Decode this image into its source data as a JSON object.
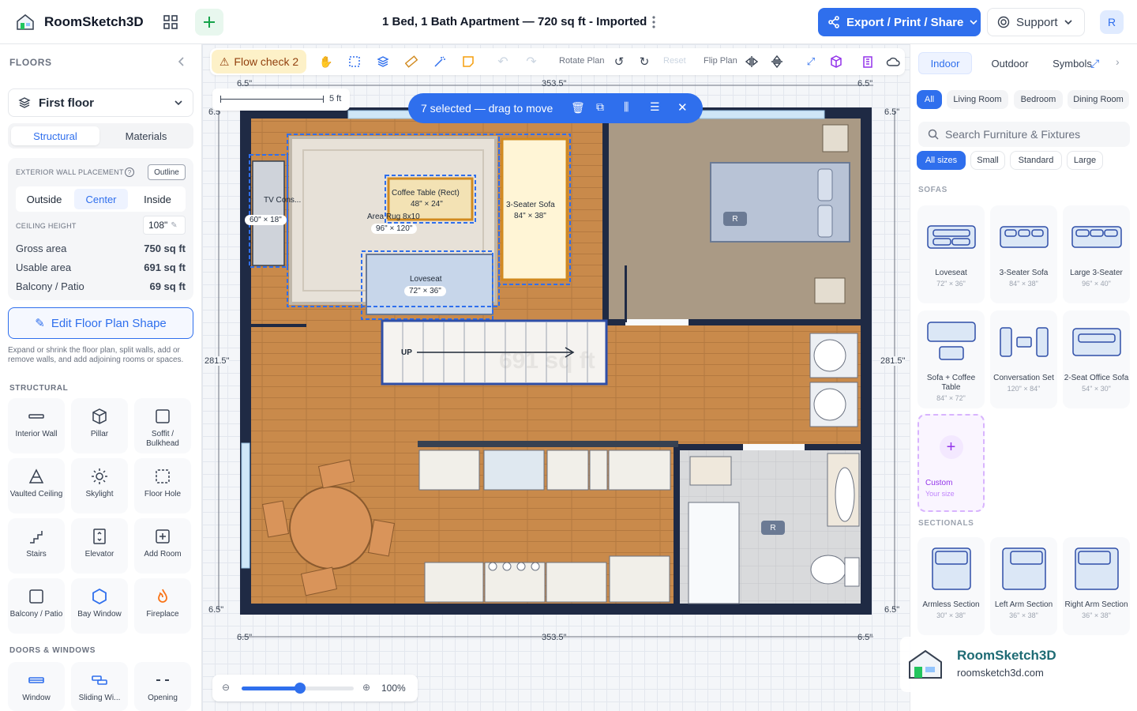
{
  "app": {
    "name": "RoomSketch3D",
    "doc_title": "1 Bed, 1 Bath Apartment — 720 sq ft - Imported",
    "export_label": "Export / Print / Share",
    "support_label": "Support",
    "avatar": "R",
    "accent": "#2f6fed"
  },
  "left": {
    "floors_header": "FLOORS",
    "floor_select": "First floor",
    "tabs": [
      "Structural",
      "Materials"
    ],
    "wall_label": "EXTERIOR WALL PLACEMENT",
    "outline_btn": "Outline",
    "wall_options": [
      "Outside",
      "Center",
      "Inside"
    ],
    "ceiling_label": "CEILING HEIGHT",
    "ceiling_value": "108\"",
    "stats": [
      {
        "label": "Gross area",
        "value": "750 sq ft"
      },
      {
        "label": "Usable area",
        "value": "691 sq ft"
      },
      {
        "label": "Balcony / Patio",
        "value": "69 sq ft"
      }
    ],
    "edit_btn": "Edit Floor Plan Shape",
    "edit_help": "Expand or shrink the floor plan, split walls, add or remove walls, and add adjoining rooms or spaces.",
    "structural_header": "STRUCTURAL",
    "structural": [
      {
        "label": "Interior Wall",
        "icon": "wall-icon"
      },
      {
        "label": "Pillar",
        "icon": "cube-icon"
      },
      {
        "label": "Soffit / Bulkhead",
        "icon": "square-icon"
      },
      {
        "label": "Vaulted Ceiling",
        "icon": "vault-icon"
      },
      {
        "label": "Skylight",
        "icon": "sun-icon"
      },
      {
        "label": "Floor Hole",
        "icon": "dashed-square-icon"
      },
      {
        "label": "Stairs",
        "icon": "stairs-icon"
      },
      {
        "label": "Elevator",
        "icon": "elevator-icon"
      },
      {
        "label": "Add Room",
        "icon": "plus-square-icon"
      },
      {
        "label": "Balcony / Patio",
        "icon": "balcony-icon"
      },
      {
        "label": "Bay Window",
        "icon": "hexagon-icon"
      },
      {
        "label": "Fireplace",
        "icon": "flame-icon"
      }
    ],
    "doors_header": "DOORS & WINDOWS",
    "doors": [
      {
        "label": "Window",
        "icon": "window-icon"
      },
      {
        "label": "Sliding Wi...",
        "icon": "sliding-window-icon"
      },
      {
        "label": "Opening",
        "icon": "opening-icon"
      }
    ]
  },
  "toolbar": {
    "flow_check": "Flow check 2",
    "rotate_plan": "Rotate Plan",
    "reset": "Reset",
    "flip_plan": "Flip Plan"
  },
  "selection": {
    "text": "7 selected — drag to move"
  },
  "plan": {
    "dim_top": "353.5\"",
    "dim_bottom": "353.5\"",
    "dim_side": "281.5\"",
    "dim_corner": "6.5\"",
    "scale": "5 ft",
    "area_watermark": "691 sq ft",
    "items": [
      {
        "name": "TV Cons...",
        "size": "60\" × 18\""
      },
      {
        "name": "Coffee Table (Rect)",
        "size": "48\" × 24\""
      },
      {
        "name": "Area Rug 8x10",
        "size": "96\" × 120\""
      },
      {
        "name": "3-Seater Sofa",
        "size": "84\" × 38\""
      },
      {
        "name": "Loveseat",
        "size": "72\" × 36\""
      }
    ],
    "stairs_label": "UP",
    "bed_tag": "R",
    "bath_tag": "R"
  },
  "zoom": {
    "value": "100%",
    "level": 0.52
  },
  "right": {
    "tabs": [
      "Indoor",
      "Outdoor",
      "Symbols"
    ],
    "rooms": [
      "All",
      "Living Room",
      "Bedroom",
      "Dining Room"
    ],
    "search_placeholder": "Search Furniture & Fixtures",
    "sizes": [
      "All sizes",
      "Small",
      "Standard",
      "Large"
    ],
    "sofas_header": "SOFAS",
    "sofas": [
      {
        "name": "Loveseat",
        "size": "72\" × 36\""
      },
      {
        "name": "3-Seater Sofa",
        "size": "84\" × 38\""
      },
      {
        "name": "Large 3-Seater",
        "size": "96\" × 40\""
      },
      {
        "name": "Sofa + Coffee Table",
        "size": "84\" × 72\""
      },
      {
        "name": "Conversation Set",
        "size": "120\" × 84\""
      },
      {
        "name": "2-Seat Office Sofa",
        "size": "54\" × 30\""
      }
    ],
    "custom": {
      "name": "Custom",
      "sub": "Your size"
    },
    "sectionals_header": "SECTIONALS",
    "sectionals": [
      {
        "name": "Armless Section",
        "size": "30\" × 38\""
      },
      {
        "name": "Left Arm Section",
        "size": "36\" × 38\""
      },
      {
        "name": "Right Arm Section",
        "size": "36\" × 38\""
      }
    ]
  },
  "watermark": {
    "name": "RoomSketch3D",
    "url": "roomsketch3d.com"
  }
}
